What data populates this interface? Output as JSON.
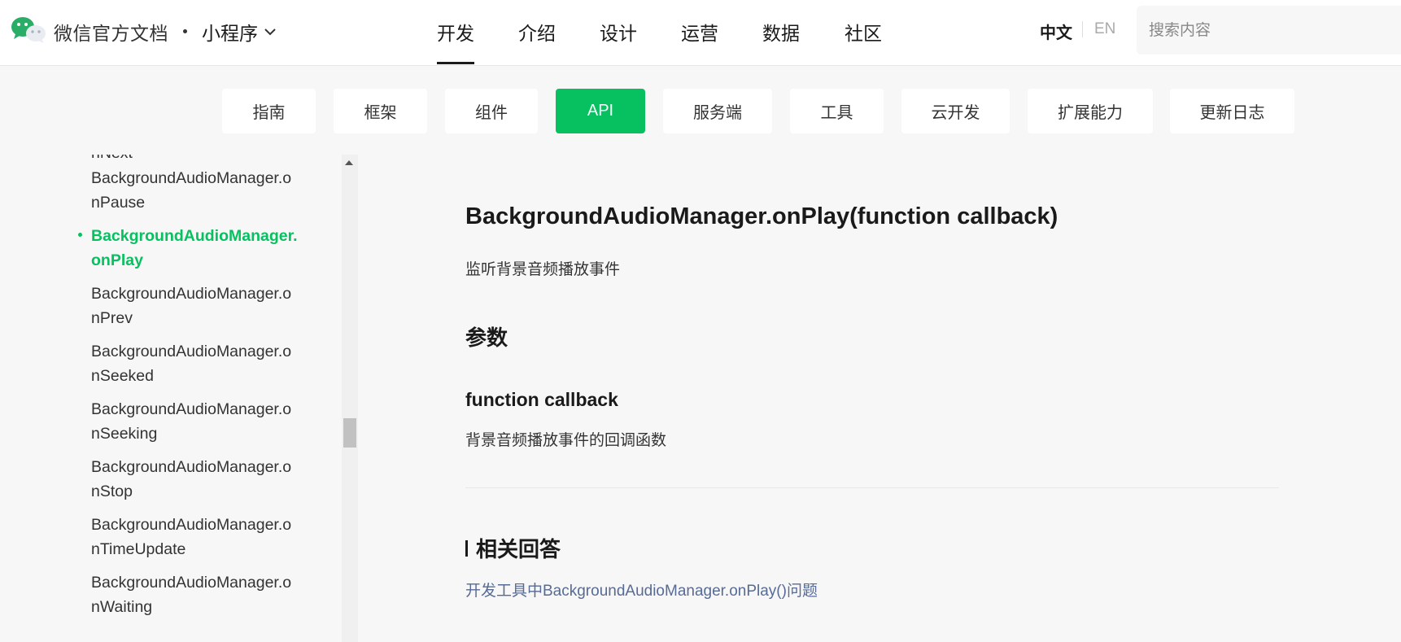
{
  "header": {
    "brand": "微信官方文档",
    "product": "小程序",
    "tabs": [
      {
        "label": "开发",
        "active": true
      },
      {
        "label": "介绍",
        "active": false
      },
      {
        "label": "设计",
        "active": false
      },
      {
        "label": "运营",
        "active": false
      },
      {
        "label": "数据",
        "active": false
      },
      {
        "label": "社区",
        "active": false
      }
    ],
    "lang_zh": "中文",
    "lang_en": "EN",
    "search_placeholder": "搜索内容"
  },
  "subnav": {
    "items": [
      {
        "label": "指南",
        "active": false
      },
      {
        "label": "框架",
        "active": false
      },
      {
        "label": "组件",
        "active": false
      },
      {
        "label": "API",
        "active": true
      },
      {
        "label": "服务端",
        "active": false
      },
      {
        "label": "工具",
        "active": false
      },
      {
        "label": "云开发",
        "active": false
      },
      {
        "label": "扩展能力",
        "active": false
      },
      {
        "label": "更新日志",
        "active": false
      }
    ]
  },
  "sidebar": {
    "items": [
      {
        "line1": "",
        "line2": "nNext",
        "active": false
      },
      {
        "line1": "BackgroundAudioManager.o",
        "line2": "nPause",
        "active": false
      },
      {
        "line1": "BackgroundAudioManager.",
        "line2": "onPlay",
        "active": true
      },
      {
        "line1": "BackgroundAudioManager.o",
        "line2": "nPrev",
        "active": false
      },
      {
        "line1": "BackgroundAudioManager.o",
        "line2": "nSeeked",
        "active": false
      },
      {
        "line1": "BackgroundAudioManager.o",
        "line2": "nSeeking",
        "active": false
      },
      {
        "line1": "BackgroundAudioManager.o",
        "line2": "nStop",
        "active": false
      },
      {
        "line1": "BackgroundAudioManager.o",
        "line2": "nTimeUpdate",
        "active": false
      },
      {
        "line1": "BackgroundAudioManager.o",
        "line2": "nWaiting",
        "active": false
      }
    ]
  },
  "content": {
    "title": "BackgroundAudioManager.onPlay(function callback)",
    "description": "监听背景音频播放事件",
    "params_heading": "参数",
    "param_name": "function callback",
    "param_desc": "背景音频播放事件的回调函数",
    "related_heading": "相关回答",
    "related_link": "开发工具中BackgroundAudioManager.onPlay()问题"
  },
  "colors": {
    "accent": "#07c160",
    "link": "#576b95"
  }
}
